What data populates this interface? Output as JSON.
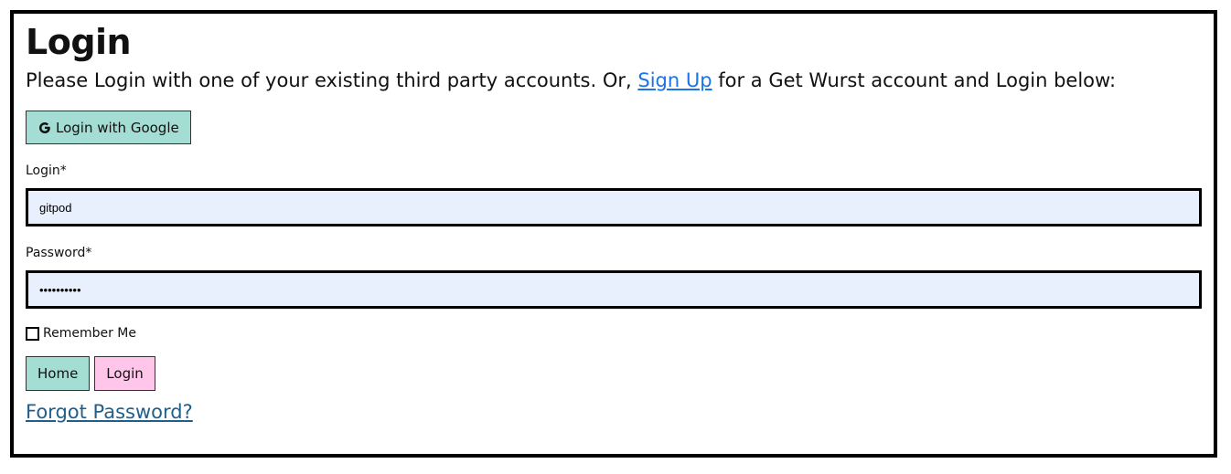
{
  "page": {
    "title": "Login",
    "intro_before": "Please Login with one of your existing third party accounts. Or, ",
    "signup_link": "Sign Up",
    "intro_after": " for a Get Wurst account and Login below:"
  },
  "social": {
    "google_label": "Login with Google",
    "google_icon": "google-g-icon"
  },
  "form": {
    "login_label": "Login*",
    "login_value": "gitpod",
    "password_label": "Password*",
    "password_value": "••••••••••",
    "remember_label": "Remember Me",
    "remember_checked": false
  },
  "buttons": {
    "home_label": "Home",
    "login_label": "Login"
  },
  "links": {
    "forgot_password": "Forgot Password?"
  },
  "colors": {
    "teal_button": "#a3ddd4",
    "pink_button": "#ffc6ea",
    "input_background": "#e8f0fe",
    "link_blue": "#1a73e8",
    "forgot_link": "#1f5f8b"
  }
}
